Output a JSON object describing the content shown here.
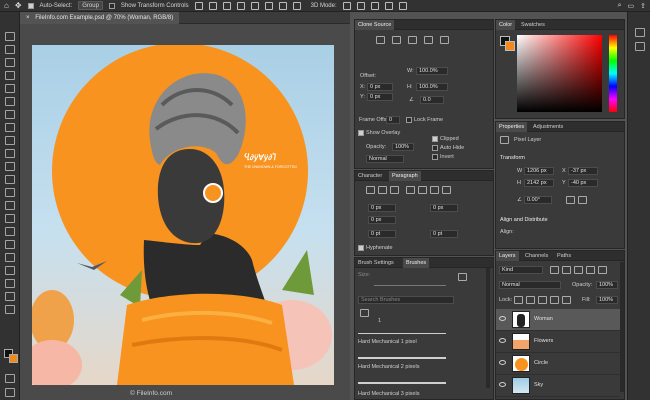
{
  "options_bar": {
    "auto_select_label": "Auto-Select:",
    "auto_select_value": "Group",
    "transform_label": "Show Transform Controls",
    "mode_label": "3D Mode:"
  },
  "document": {
    "tab_title": "FileInfo.com Example.psd @ 70% (Woman, RGB/8)"
  },
  "artwork": {
    "logo_text": "Ⴁ∂ÿ∀ÿ∂Ⴈ",
    "logo_tagline": "THE UNKNOWN & FORGOTTEN"
  },
  "credit": "© FileInfo.com",
  "clone_source": {
    "title": "Clone Source",
    "offset_label": "Offset:",
    "x_label": "X:",
    "x_value": "0 px",
    "y_label": "Y:",
    "y_value": "0 px",
    "w_label": "W:",
    "w_value": "100.0%",
    "h_label": "H:",
    "h_value": "100.0%",
    "angle_value": "0.0",
    "frame_offset_label": "Frame Offset:",
    "frame_offset_value": "0",
    "lock_frame_label": "Lock Frame",
    "show_overlay_label": "Show Overlay",
    "clipped_label": "Clipped",
    "opacity_label": "Opacity:",
    "opacity_value": "100%",
    "auto_hide_label": "Auto Hide",
    "invert_label": "Invert",
    "blend_value": "Normal"
  },
  "character_panel": {
    "tabs": [
      "Character",
      "Paragraph"
    ],
    "fields": [
      "0 px",
      "0 px",
      "0 px",
      "0 px",
      "0 pt",
      "0 pt"
    ],
    "hyphenate_label": "Hyphenate"
  },
  "brushes_panel": {
    "tabs": [
      "Brush Settings",
      "Brushes"
    ],
    "size_label": "Size:",
    "search_placeholder": "Search Brushes",
    "brush_size": "1",
    "brushes": [
      "Hard Mechanical 1 pixel",
      "Hard Mechanical 2 pixels",
      "Hard Mechanical 3 pixels"
    ]
  },
  "color_panel": {
    "tabs": [
      "Color",
      "Swatches"
    ]
  },
  "properties_panel": {
    "tabs": [
      "Properties",
      "Adjustments"
    ],
    "layer_type": "Pixel Layer",
    "transform_label": "Transform",
    "w_label": "W",
    "w_value": "1206 px",
    "h_label": "H",
    "h_value": "2142 px",
    "x_label": "X",
    "x_value": "-37 px",
    "y_label": "Y",
    "y_value": "-40 px",
    "angle_value": "0.00°",
    "align_label": "Align and Distribute",
    "align_sub": "Align:"
  },
  "layers_panel": {
    "tabs": [
      "Layers",
      "Channels",
      "Paths"
    ],
    "kind_value": "Kind",
    "blend_value": "Normal",
    "opacity_label": "Opacity:",
    "opacity_value": "100%",
    "lock_label": "Lock:",
    "fill_label": "Fill:",
    "fill_value": "100%",
    "layers": [
      "Woman",
      "Flowers",
      "Circle",
      "Sky"
    ]
  }
}
